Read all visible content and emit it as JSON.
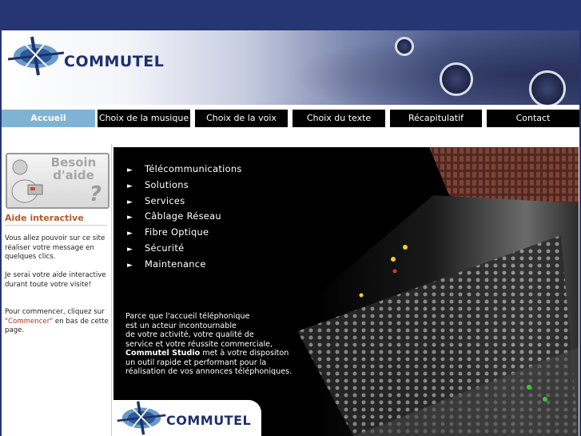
{
  "brand": {
    "name": "COMMUTEL"
  },
  "nav": {
    "items": [
      {
        "label": "Accueil",
        "active": true
      },
      {
        "label": "Choix de la musique"
      },
      {
        "label": "Choix de la voix"
      },
      {
        "label": "Choix du texte"
      },
      {
        "label": "Récapitulatif"
      },
      {
        "label": "Contact"
      }
    ]
  },
  "sidebar": {
    "help_image": {
      "line1": "Besoin",
      "line2": "d'aide",
      "mark": "?"
    },
    "title": "Aide interactive",
    "p1": "Vous allez pouvoir sur ce site réaliser votre message en quelques clics.",
    "p2": "Je serai votre aide interactive durant toute votre visite!",
    "p3_pre": "Pour commencer, cliquez sur ",
    "p3_link": "\"Commencer\"",
    "p3_post": " en bas de cette page."
  },
  "services": {
    "bullet": "►",
    "items": [
      "Télécommunications",
      "Solutions",
      "Services",
      "Câblage Réseau",
      "Fibre Optique",
      "Sécurité",
      "Maintenance"
    ]
  },
  "intro": {
    "l1": "Parce que l'accueil téléphonique",
    "l2": "est un acteur incontournable",
    "l3": "de votre activité, votre qualité de",
    "l4": "service et votre réussite commerciale,",
    "l5_bold": "Commutel Studio",
    "l5_rest": " met à votre dispositon",
    "l6": "un outil rapide et performant pour la",
    "l7": "réalisation de vos annonces téléphoniques."
  },
  "colors": {
    "top_band": "#263574",
    "nav_active": "#7fb3d4",
    "nav_bg": "#000000",
    "aide_title": "#b35c2a",
    "link": "#b3341e"
  },
  "icons": {
    "logo": "commutel-star-logo-icon",
    "help": "help-character-icon",
    "bullet": "triangle-right-icon"
  }
}
